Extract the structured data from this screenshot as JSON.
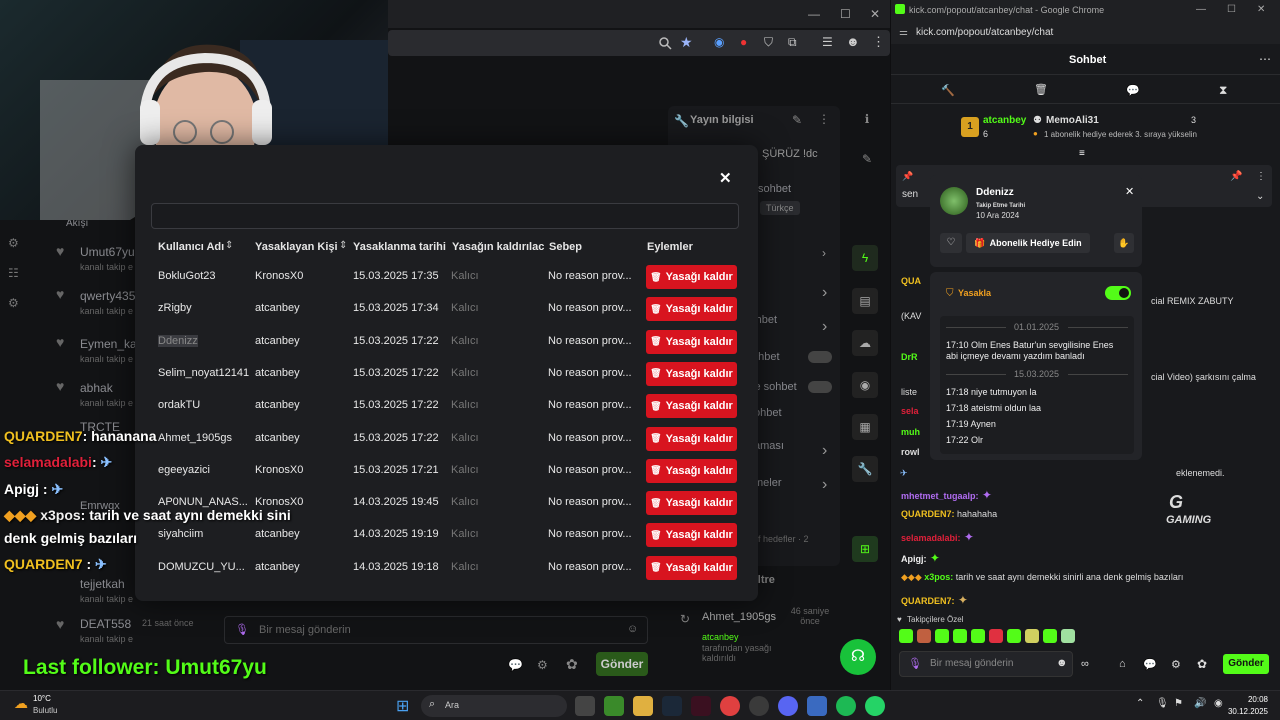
{
  "left_window": {
    "title_controls": [
      "—",
      "☐",
      "✕"
    ]
  },
  "dashboard": {
    "panel_title": "Yayın bilgisi",
    "partial_text": "ŞÜRÜZ !dc",
    "labels": [
      "sohbet",
      "Türkçe",
      "eri",
      "sohbet",
      "ohbet",
      "le sohbet",
      "ohbet",
      "aması",
      "meler"
    ],
    "filter_label": "Filtre",
    "chat_placeholder": "Bir mesaj gönderin",
    "send_label": "Gönder",
    "hedefler": "f hedefler · 2",
    "mod_log": {
      "user": "Ahmet_1905gs",
      "time": "46 saniye önce",
      "line1": "atcanbey",
      "line2": "tarafından yasağı kaldırıldı"
    },
    "follower_list": [
      {
        "name": "Umut67yu",
        "sub": "kanalı takip e"
      },
      {
        "name": "qwerty435",
        "sub": "kanalı takip e"
      },
      {
        "name": "Eymen_kar",
        "sub": "kanalı takip e"
      },
      {
        "name": "abhak",
        "sub": "kanalı takip e"
      },
      {
        "name": "TRCTE",
        "sub": ""
      },
      {
        "name": "Emrwqx",
        "sub": ""
      },
      {
        "name": "tejjetkah",
        "sub": "kanalı takip e"
      },
      {
        "name": "DEAT558",
        "sub": "kanalı takip e",
        "time": "21 saat önce"
      }
    ],
    "akis": "Akışı"
  },
  "modal": {
    "close": "✕",
    "columns": [
      "Kullanıcı Adı",
      "Yasaklayan Kişi",
      "Yasaklanma tarihi",
      "Yasağın kaldırılaca",
      "Sebep",
      "Eylemler"
    ],
    "rows": [
      {
        "user": "BokluGot23",
        "by": "KronosX0",
        "date": "15.03.2025 17:35",
        "until": "Kalıcı",
        "reason": "No reason prov...",
        "action": "Yasağı kaldır"
      },
      {
        "user": "zRigby",
        "by": "atcanbey",
        "date": "15.03.2025 17:34",
        "until": "Kalıcı",
        "reason": "No reason prov...",
        "action": "Yasağı kaldır"
      },
      {
        "user": "Ddenizz",
        "by": "atcanbey",
        "date": "15.03.2025 17:22",
        "until": "Kalıcı",
        "reason": "No reason prov...",
        "action": "Yasağı kaldır"
      },
      {
        "user": "Selim_noyat12141",
        "by": "atcanbey",
        "date": "15.03.2025 17:22",
        "until": "Kalıcı",
        "reason": "No reason prov...",
        "action": "Yasağı kaldır"
      },
      {
        "user": "ordakTU",
        "by": "atcanbey",
        "date": "15.03.2025 17:22",
        "until": "Kalıcı",
        "reason": "No reason prov...",
        "action": "Yasağı kaldır"
      },
      {
        "user": "Ahmet_1905gs",
        "by": "atcanbey",
        "date": "15.03.2025 17:22",
        "until": "Kalıcı",
        "reason": "No reason prov...",
        "action": "Yasağı kaldır"
      },
      {
        "user": "egeeyazici",
        "by": "KronosX0",
        "date": "15.03.2025 17:21",
        "until": "Kalıcı",
        "reason": "No reason prov...",
        "action": "Yasağı kaldır"
      },
      {
        "user": "AP0NUN_ANAS...",
        "by": "KronosX0",
        "date": "14.03.2025 19:45",
        "until": "Kalıcı",
        "reason": "No reason prov...",
        "action": "Yasağı kaldır"
      },
      {
        "user": "siyahciim",
        "by": "atcanbey",
        "date": "14.03.2025 19:19",
        "until": "Kalıcı",
        "reason": "No reason prov...",
        "action": "Yasağı kaldır"
      },
      {
        "user": "DOMUZCU_YU...",
        "by": "atcanbey",
        "date": "14.03.2025 19:18",
        "until": "Kalıcı",
        "reason": "No reason prov...",
        "action": "Yasağı kaldır"
      }
    ]
  },
  "overlay_chat": [
    {
      "user": "QUARDEN7",
      "msg": ": hananana",
      "color": "#f0c020"
    },
    {
      "user": "selamadalabi",
      "msg": ":",
      "color": "#e0203a"
    },
    {
      "user": "Apigj",
      "msg": ":",
      "color": "#f0f0f0"
    },
    {
      "user": "x3pos",
      "msg": ": tarih ve saat aynı demekki sini",
      "color": "#f0f0f0"
    },
    {
      "user": "",
      "msg": "denk gelmiş bazıları",
      "color": "#f0f0f0"
    },
    {
      "user": "QUARDEN7",
      "msg": ":",
      "color": "#f0c020"
    }
  ],
  "last_follower": "Last follower: Umut67yu",
  "right_window": {
    "title": "kick.com/popout/atcanbey/chat - Google Chrome",
    "url": "kick.com/popout/atcanbey/chat",
    "chat_title": "Sohbet",
    "menu": "⋯",
    "leaderboard": {
      "first_name": "atcanbey",
      "first_count": "6",
      "second_name": "MemoAli31",
      "second_count": "3",
      "second_note": "1 abonelik hediye ederek 3. sıraya yükselin"
    },
    "user_popup": {
      "name": "Ddenizz",
      "follow_label": "Takip Etme Tarihi",
      "follow_date": "10 Ara 2024",
      "gift_button": "Abonelik Hediye Edin"
    },
    "ban_popup": {
      "label": "Yasakla",
      "date1": "01.01.2025",
      "lines1": [
        "17:10 Olm Enes Batur'un sevgilisine Enes",
        "abi içmeye devamı yazdım banladı"
      ],
      "date2": "15.03.2025",
      "lines2": [
        "17:18 niye tutmuyon la",
        "17:18 ateistmi oldun laa",
        "17:19 Aynen",
        "17:22 Olr"
      ]
    },
    "chat_fragments": [
      {
        "text": "sen",
        "color": "#ddd"
      },
      {
        "text": "QUA",
        "color": "#f0c020"
      },
      {
        "text": "(KAV",
        "color": "#ddd"
      },
      {
        "text": "DrR",
        "color": "#53fc18"
      },
      {
        "text": "liste",
        "color": "#ddd"
      },
      {
        "text": "sela",
        "color": "#e0203a"
      },
      {
        "text": "muh",
        "color": "#53fc18"
      },
      {
        "text": "rowl",
        "color": "#ddd"
      }
    ],
    "chat_right_fragments": [
      "cial REMIX ZABUTY",
      "cial Video) şarkısını çalma"
    ],
    "chat_lines": [
      {
        "user": "mhetmet_tugaalp:",
        "msg": "",
        "color": "#b06cf0"
      },
      {
        "user": "QUARDEN7:",
        "msg": "hahahaha",
        "color": "#f0c020"
      },
      {
        "user": "selamadalabi:",
        "msg": "",
        "color": "#e0203a"
      },
      {
        "user": "Apigj:",
        "msg": "",
        "color": "#f0f0f0"
      },
      {
        "user": "x3pos:",
        "msg": "tarih ve saat aynı demekki sinirli ana denk gelmiş bazıları",
        "color": "#53fc18"
      },
      {
        "user": "QUARDEN7:",
        "msg": "",
        "color": "#f0c020"
      }
    ],
    "partial_line": "eklenemedi.",
    "emote_label": "Takipçilere Özel",
    "input_placeholder": "Bir mesaj gönderin",
    "send": "Gönder",
    "gaming_logo": "GAMING"
  },
  "taskbar": {
    "weather_temp": "10°C",
    "weather_desc": "Bulutlu",
    "search": "Ara",
    "time": "20:08",
    "date": "30.12.2025"
  }
}
